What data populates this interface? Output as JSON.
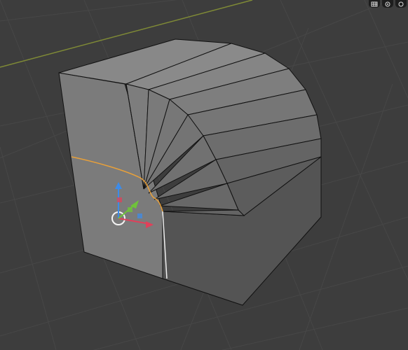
{
  "viewport": {
    "mode": "edit-mode",
    "object": "cube-with-rounded-corner",
    "colors": {
      "background": "#3d3d3d",
      "grid_line": "#474747",
      "x_axis": "#7f8a36",
      "face_front": "#7b7b7b",
      "face_side": "#545454",
      "face_top": "#888888",
      "edge": "#111111",
      "selected_edge": "#e8a03a",
      "seam_highlight": "#f0f0f0"
    }
  },
  "header_icons": [
    "shading-grid-icon",
    "overlay-icon",
    "viewport-shading-icon"
  ],
  "gizmo": {
    "axes": [
      "x",
      "y",
      "z"
    ],
    "colors": {
      "x": "#e0405a",
      "y": "#6fc33a",
      "z": "#3d8be8"
    }
  }
}
